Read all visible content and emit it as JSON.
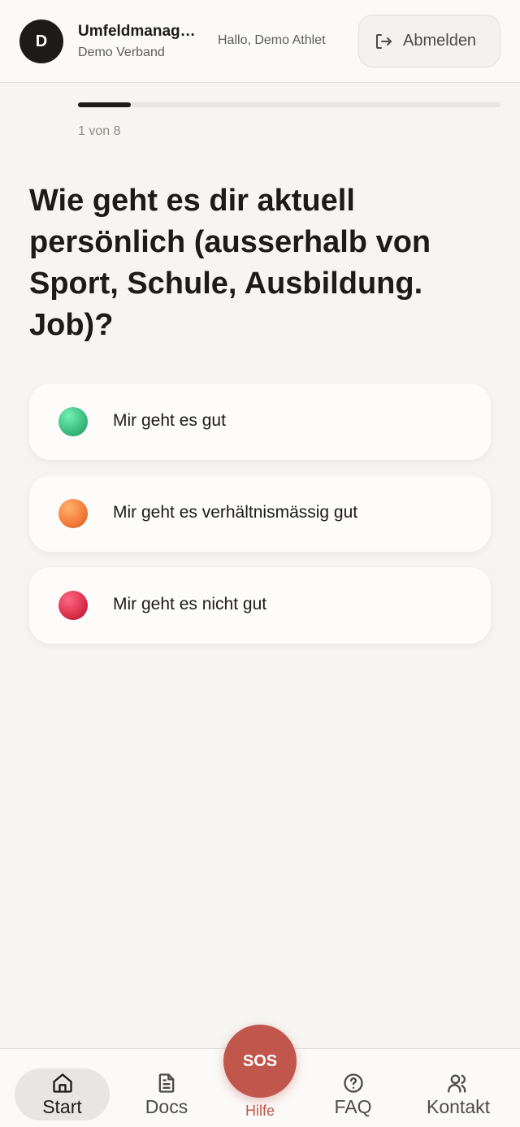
{
  "header": {
    "avatar_initial": "D",
    "org_name": "Umfeldmanagement",
    "org_subtitle": "Demo Verband",
    "greeting": "Hallo, Demo Athlet",
    "logout_label": "Abmelden",
    "logout_icon": "logout-icon"
  },
  "progress": {
    "current": 1,
    "total": 8,
    "label": "1 von 8",
    "fraction": 0.125
  },
  "question": {
    "text": "Wie geht es dir aktuell persönlich (ausserhalb von Sport, Schule, Ausbildung. Job)?"
  },
  "options": [
    {
      "label": "Mir geht es gut",
      "color": "#3fbf82"
    },
    {
      "label": "Mir geht es verhältnismässig gut",
      "color": "#f57f3c"
    },
    {
      "label": "Mir geht es nicht gut",
      "color": "#dc3550"
    }
  ],
  "bottom_nav": {
    "start": {
      "label": "Start",
      "icon": "home-icon"
    },
    "docs": {
      "label": "Docs",
      "icon": "document-icon"
    },
    "sos": {
      "label": "SOS",
      "caption": "Hilfe",
      "color": "#c0564c"
    },
    "faq": {
      "label": "FAQ",
      "icon": "question-icon"
    },
    "kontakt": {
      "label": "Kontakt",
      "icon": "users-icon"
    }
  }
}
